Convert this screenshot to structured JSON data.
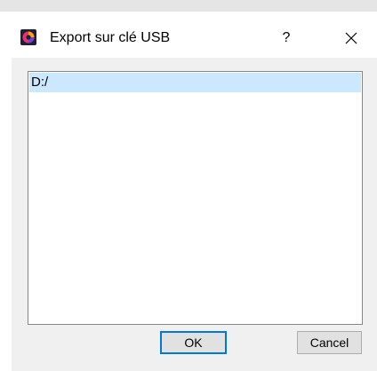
{
  "window": {
    "title": "Export sur clé USB",
    "help_label": "?",
    "app_icon": "app-logo-icon",
    "close_icon": "close-icon"
  },
  "list": {
    "items": [
      {
        "label": "D:/",
        "selected": true
      }
    ]
  },
  "buttons": {
    "ok_label": "OK",
    "cancel_label": "Cancel"
  },
  "colors": {
    "selection": "#cce8ff",
    "default_button_border": "#0078d7",
    "dialog_background": "#f0f0f0"
  }
}
